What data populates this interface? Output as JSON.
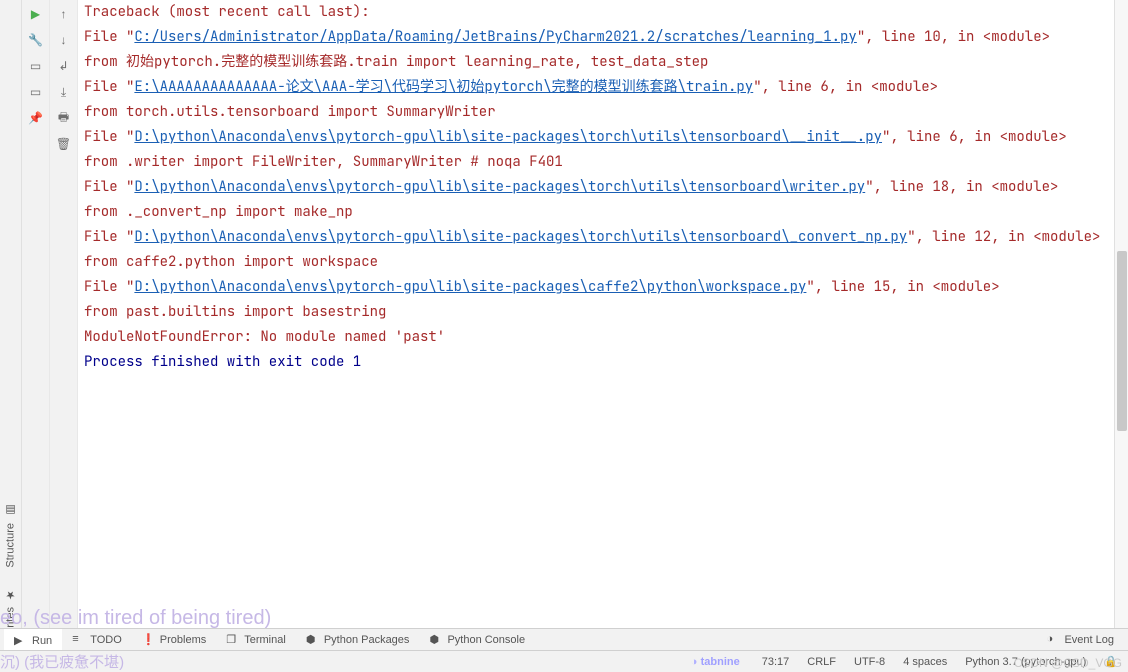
{
  "sidebar_labels": {
    "structure": "Structure",
    "favorites": "Favorites"
  },
  "traceback": {
    "header": "Traceback (most recent call last):",
    "frames": [
      {
        "prefix": "  File \"",
        "path": "C:/Users/Administrator/AppData/Roaming/JetBrains/PyCharm2021.2/scratches/learning_1.py",
        "suffix": "\", line 10, in <module>",
        "code": "    from 初始pytorch.完整的模型训练套路.train import learning_rate, test_data_step"
      },
      {
        "prefix": "  File \"",
        "path": "E:\\AAAAAAAAAAAAAA-论文\\AAA-学习\\代码学习\\初始pytorch\\完整的模型训练套路\\train.py",
        "suffix": "\", line 6, in <module>",
        "code": "    from torch.utils.tensorboard import SummaryWriter"
      },
      {
        "prefix": "  File \"",
        "path": "D:\\python\\Anaconda\\envs\\pytorch-gpu\\lib\\site-packages\\torch\\utils\\tensorboard\\__init__.py",
        "suffix": "\", line 6, in <module>",
        "code": "    from .writer import FileWriter, SummaryWriter  # noqa F401"
      },
      {
        "prefix": "  File \"",
        "path": "D:\\python\\Anaconda\\envs\\pytorch-gpu\\lib\\site-packages\\torch\\utils\\tensorboard\\writer.py",
        "suffix": "\", line 18, in <module>",
        "code": "    from ._convert_np import make_np"
      },
      {
        "prefix": "  File \"",
        "path": "D:\\python\\Anaconda\\envs\\pytorch-gpu\\lib\\site-packages\\torch\\utils\\tensorboard\\_convert_np.py",
        "suffix": "\", line 12, in <module>",
        "code": "    from caffe2.python import workspace"
      },
      {
        "prefix": "  File \"",
        "path": "D:\\python\\Anaconda\\envs\\pytorch-gpu\\lib\\site-packages\\caffe2\\python\\workspace.py",
        "suffix": "\", line 15, in <module>",
        "code": "    from past.builtins import basestring"
      }
    ],
    "error": "ModuleNotFoundError: No module named 'past'",
    "exit": "Process finished with exit code 1"
  },
  "bottom_tabs": {
    "run": "Run",
    "todo": "TODO",
    "problems": "Problems",
    "terminal": "Terminal",
    "python_packages": "Python Packages",
    "python_console": "Python Console",
    "event_log": "Event Log"
  },
  "status": {
    "tabnine": "tabnine",
    "cursor": "73:17",
    "line_sep": "CRLF",
    "encoding": "UTF-8",
    "indent": "4 spaces",
    "interpreter": "Python 3.7 (pytorch-gpu)"
  },
  "watermark": "CSDN @CSD_VGG",
  "ghost1": "eo, (see im tired of being tired)",
  "ghost2": "沉)   (我已疲惫不堪)"
}
